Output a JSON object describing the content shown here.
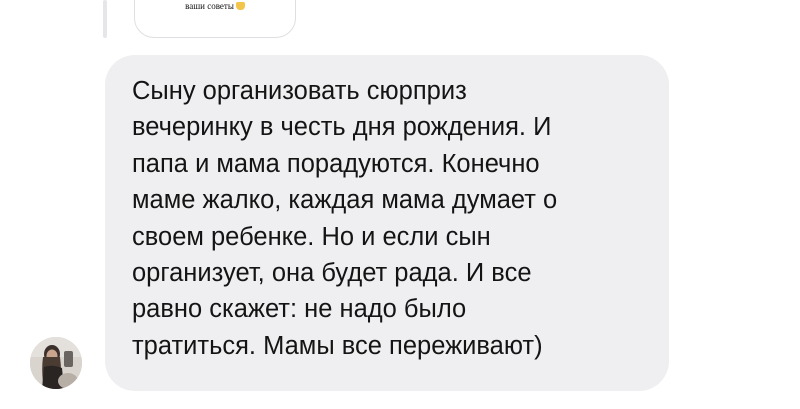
{
  "quoted_message": {
    "text": "ваши советы",
    "emoji": "hands-emoji"
  },
  "message": {
    "lines": [
      "Сыну организовать сюрприз",
      "вечеринку в честь дня рождения. И",
      "папа и мама порадуются. Конечно",
      "маме жалко, каждая мама думает о",
      "своем ребенке. Но и если сын",
      "организует, она будет рада. И все",
      "равно скажет: не надо было",
      "тратиться. Мамы все переживают)"
    ]
  },
  "sender": {
    "avatar": "user-avatar-photo"
  },
  "colors": {
    "bubble_background": "#efeff1",
    "text": "#141414",
    "reply_line": "#e6e6e8"
  }
}
